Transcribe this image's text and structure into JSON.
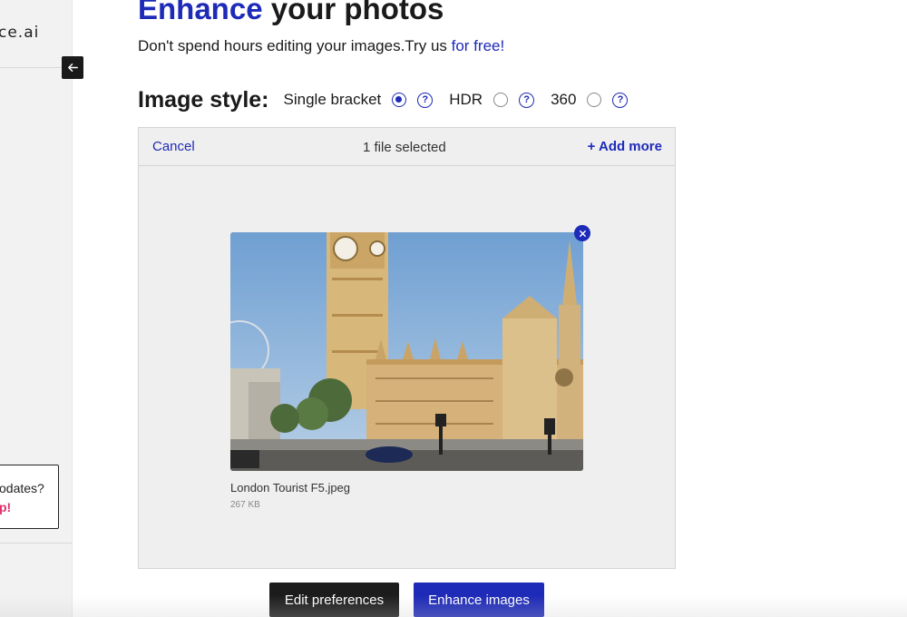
{
  "sidebar": {
    "logo_text": "ce.ai",
    "newsletter_question": "odates?",
    "newsletter_cta": "p!"
  },
  "header": {
    "title_accent": "Enhance",
    "title_rest": " your photos",
    "subtitle_main": "Don't spend hours editing your images.Try us ",
    "subtitle_link": "for free!"
  },
  "image_style": {
    "label": "Image style:",
    "options": [
      {
        "label": "Single bracket",
        "checked": true
      },
      {
        "label": "HDR",
        "checked": false
      },
      {
        "label": "360",
        "checked": false
      }
    ],
    "help_glyph": "?"
  },
  "upload": {
    "cancel_label": "Cancel",
    "selection_status": "1 file selected",
    "add_more_label": "+ Add more",
    "file": {
      "name": "London Tourist F5.jpeg",
      "size": "267 KB"
    }
  },
  "actions": {
    "edit_label": "Edit preferences",
    "enhance_label": "Enhance images"
  },
  "colors": {
    "accent": "#1e2ab8",
    "dark_button": "#1c1c1c",
    "cta_pink": "#e0306e",
    "panel_bg": "#efefef"
  },
  "icons": {
    "collapse": "arrow-left-icon",
    "help": "question-circle-icon",
    "remove": "close-icon"
  }
}
